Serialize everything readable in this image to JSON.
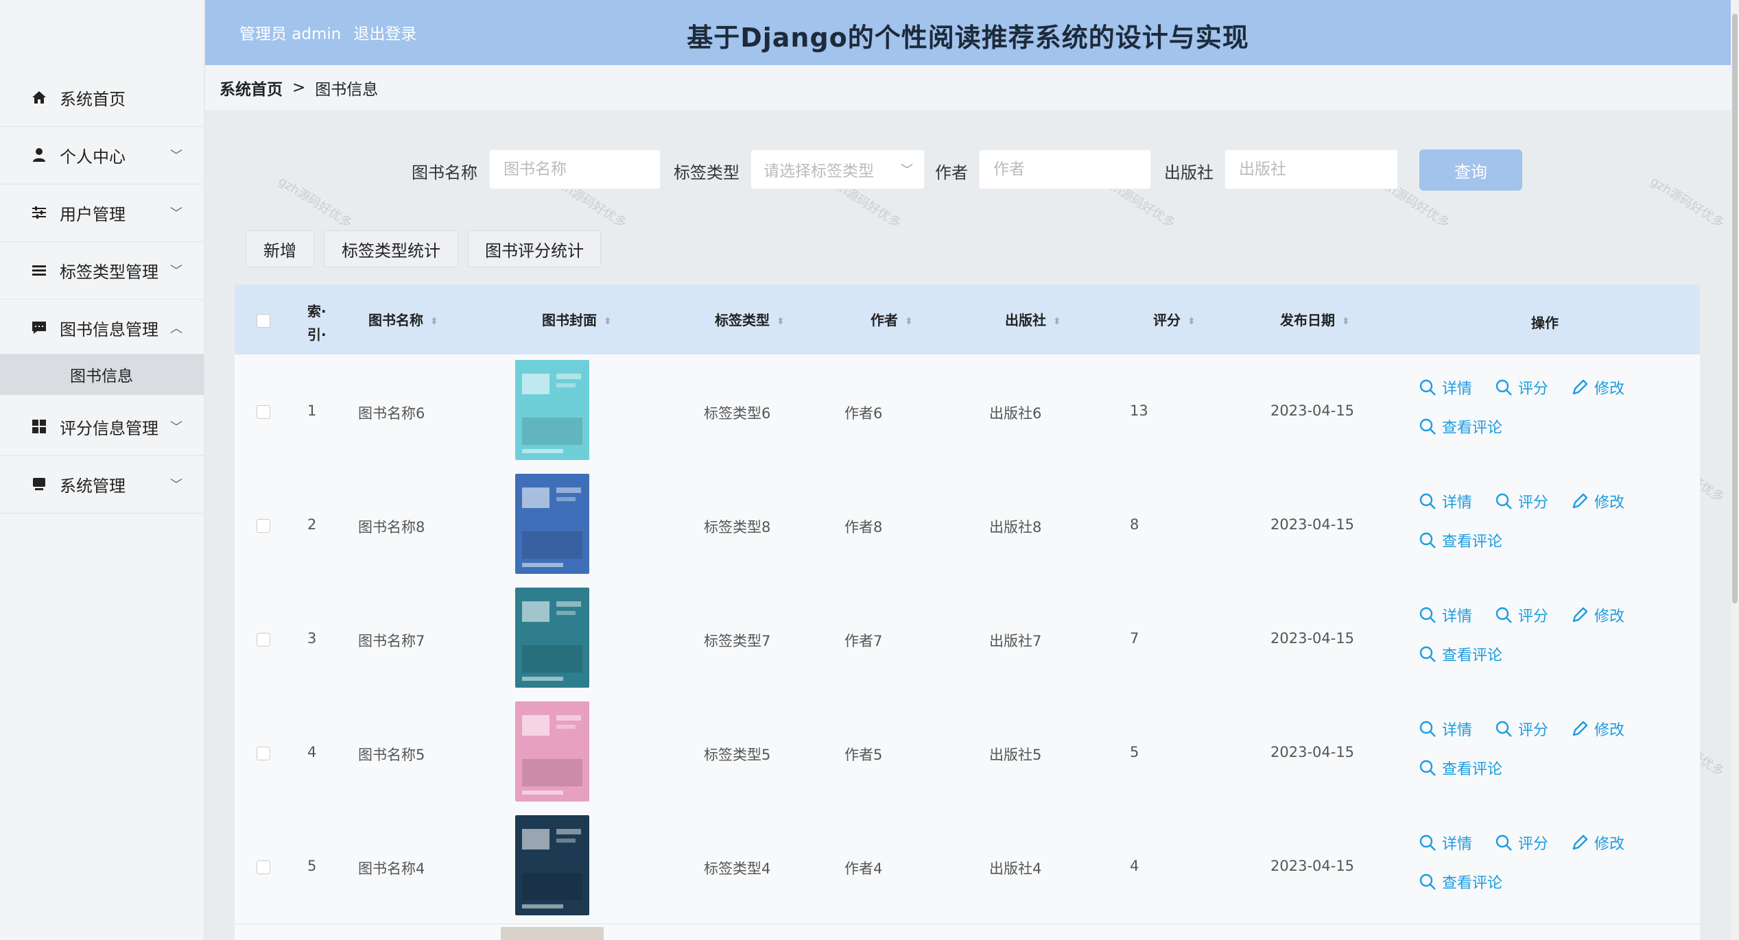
{
  "header": {
    "admin_label": "管理员 admin",
    "logout_label": "退出登录",
    "title": "基于Django的个性阅读推荐系统的设计与实现"
  },
  "sidebar": {
    "items": [
      {
        "label": "系统首页",
        "icon": "home-icon"
      },
      {
        "label": "个人中心",
        "icon": "user-icon"
      },
      {
        "label": "用户管理",
        "icon": "sliders-icon"
      },
      {
        "label": "标签类型管理",
        "icon": "list-icon"
      },
      {
        "label": "图书信息管理",
        "icon": "message-icon"
      },
      {
        "label": "评分信息管理",
        "icon": "grid-icon"
      },
      {
        "label": "系统管理",
        "icon": "system-icon"
      }
    ],
    "sub_item": "图书信息"
  },
  "breadcrumb": {
    "home": "系统首页",
    "separator": ">",
    "current": "图书信息"
  },
  "search": {
    "name_label": "图书名称",
    "name_placeholder": "图书名称",
    "tag_label": "标签类型",
    "tag_placeholder": "请选择标签类型",
    "author_label": "作者",
    "author_placeholder": "作者",
    "publisher_label": "出版社",
    "publisher_placeholder": "出版社",
    "query_button": "查询"
  },
  "actions": {
    "add": "新增",
    "tag_stats": "标签类型统计",
    "rating_stats": "图书评分统计"
  },
  "table": {
    "headers": {
      "index_1": "索·",
      "index_2": "引·",
      "name": "图书名称",
      "cover": "图书封面",
      "tag": "标签类型",
      "author": "作者",
      "publisher": "出版社",
      "rating": "评分",
      "date": "发布日期",
      "ops": "操作"
    },
    "op_labels": {
      "detail": "详情",
      "rate": "评分",
      "edit": "修改",
      "comments": "查看评论"
    },
    "rows": [
      {
        "index": "1",
        "name": "图书名称6",
        "tag": "标签类型6",
        "author": "作者6",
        "publisher": "出版社6",
        "rating": "13",
        "date": "2023-04-15",
        "cover_color": "#6fcfd9"
      },
      {
        "index": "2",
        "name": "图书名称8",
        "tag": "标签类型8",
        "author": "作者8",
        "publisher": "出版社8",
        "rating": "8",
        "date": "2023-04-15",
        "cover_color": "#3f6fb8"
      },
      {
        "index": "3",
        "name": "图书名称7",
        "tag": "标签类型7",
        "author": "作者7",
        "publisher": "出版社7",
        "rating": "7",
        "date": "2023-04-15",
        "cover_color": "#2f7e8e"
      },
      {
        "index": "4",
        "name": "图书名称5",
        "tag": "标签类型5",
        "author": "作者5",
        "publisher": "出版社5",
        "rating": "5",
        "date": "2023-04-15",
        "cover_color": "#e8a0c0"
      },
      {
        "index": "5",
        "name": "图书名称4",
        "tag": "标签类型4",
        "author": "作者4",
        "publisher": "出版社4",
        "rating": "4",
        "date": "2023-04-15",
        "cover_color": "#1e3a52"
      }
    ]
  },
  "watermark": "gzh源码好优多"
}
